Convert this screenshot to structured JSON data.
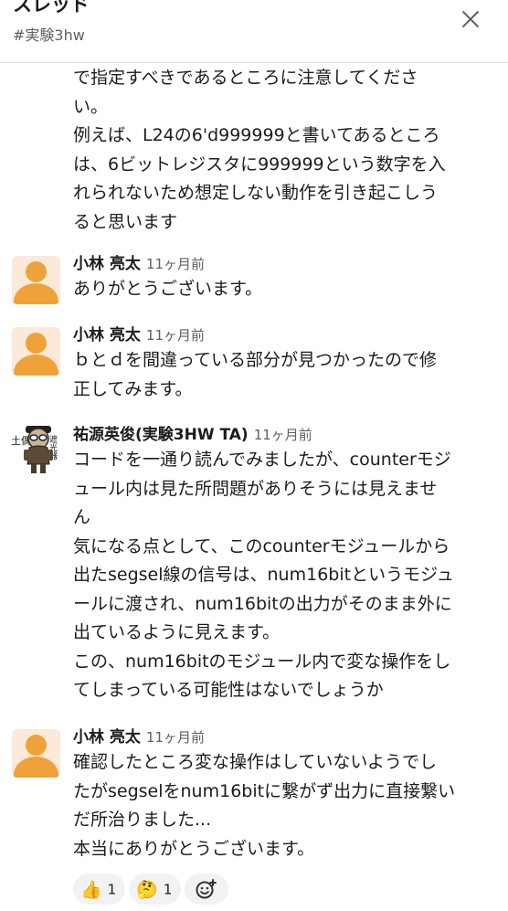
{
  "header": {
    "title": "スレッド",
    "channel": "#実験3hw"
  },
  "first_message_tail": [
    "で指定すべきであるところに注意してくださ",
    "い。",
    "例えば、L24の6'd999999と書いてあるところ",
    "は、6ビットレジスタに999999という数字を入",
    "れられないため想定しない動作を引き起こしう",
    "ると思います"
  ],
  "messages": [
    {
      "author": "小林 亮太",
      "time": "11ヶ月前",
      "lines": [
        "ありがとうございます。"
      ]
    },
    {
      "author": "小林 亮太",
      "time": "11ヶ月前",
      "lines": [
        "ｂとｄを間違っている部分が見つかったので修",
        "正してみます。"
      ]
    },
    {
      "author": "祐源英俊(実験3HW TA)",
      "time": "11ヶ月前",
      "avatar_text": [
        "土偶",
        "遮光器"
      ],
      "lines": [
        "コードを一通り読んでみましたが、counterモジ",
        "ュール内は見た所問題がありそうには見えませ",
        "ん",
        "気になる点として、このcounterモジュールから",
        "出たsegsel線の信号は、num16bitというモジュ",
        "ールに渡され、num16bitの出力がそのまま外に",
        "出ているように見えます。",
        "この、num16bitのモジュール内で変な操作をし",
        "てしまっている可能性はないでしょうか"
      ]
    },
    {
      "author": "小林 亮太",
      "time": "11ヶ月前",
      "lines": [
        "確認したところ変な操作はしていないようでし",
        "たがsegselをnum16bitに繋がず出力に直接繋い",
        "だ所治りました...",
        "本当にありがとうございます。"
      ]
    }
  ],
  "reactions": [
    {
      "emoji": "👍",
      "icon": "thumbs-up-emoji",
      "count": "1"
    },
    {
      "emoji": "🤔",
      "icon": "thinking-face-emoji",
      "count": "1"
    }
  ],
  "add_reaction_icon": "add-emoji-icon"
}
